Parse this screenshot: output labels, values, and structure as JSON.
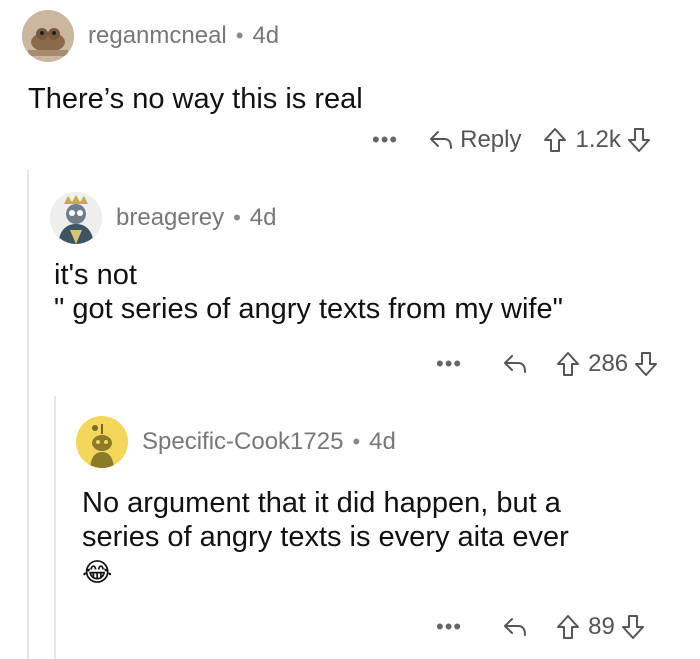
{
  "comments": [
    {
      "author": "reganmcneal",
      "separator": "•",
      "age": "4d",
      "lines": [
        "There’s no way this is real"
      ],
      "more": "•••",
      "reply_label": "Reply",
      "score": "1.2k"
    },
    {
      "author": "breagerey",
      "separator": "•",
      "age": "4d",
      "lines": [
        "it's not",
        "\" got series of angry texts from my wife\""
      ],
      "more": "•••",
      "reply_label": "",
      "score": "286"
    },
    {
      "author": "Specific-Cook1725",
      "separator": "•",
      "age": "4d",
      "lines": [
        "No argument that it did happen, but a",
        "series of angry texts is every aita ever"
      ],
      "emoji": "😂",
      "more": "•••",
      "reply_label": "",
      "score": "89"
    }
  ],
  "colors": {
    "text": "#111111",
    "meta": "#777777",
    "thread_line": "#e6e6e6",
    "snoo_bg": "#f4d75a"
  }
}
